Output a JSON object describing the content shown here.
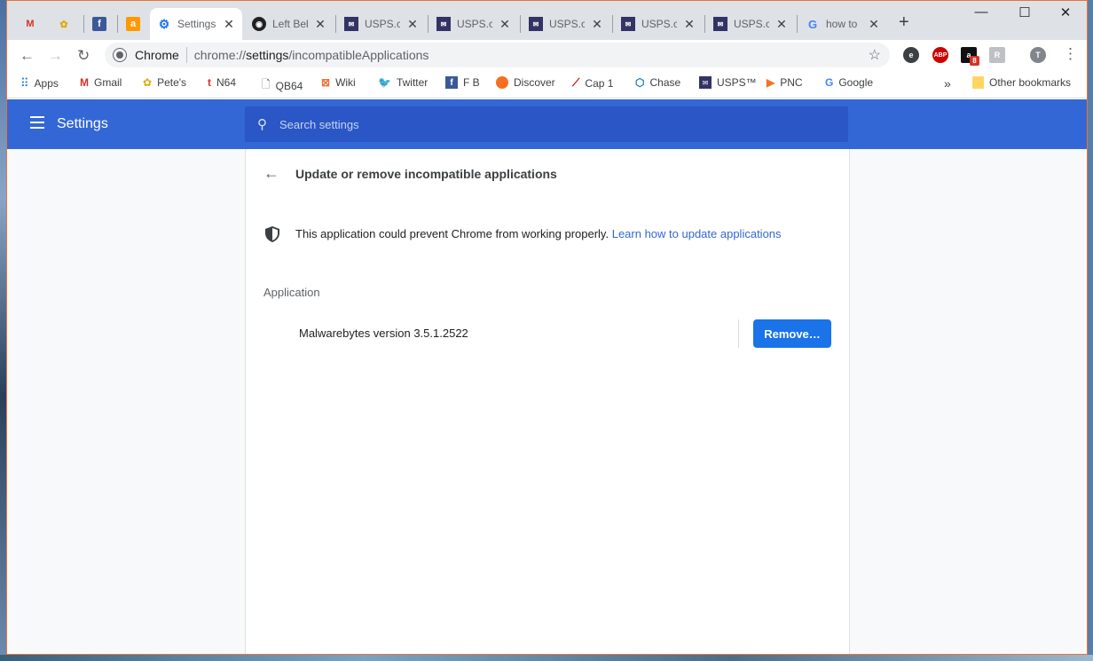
{
  "tabs": [
    {
      "title": "",
      "icon": "gmail-icon"
    },
    {
      "title": "",
      "icon": "petes-icon"
    },
    {
      "title": "",
      "icon": "facebook-icon"
    },
    {
      "title": "",
      "icon": "amazon-icon"
    },
    {
      "title": "Settings",
      "icon": "gear-icon",
      "active": true
    },
    {
      "title": "Left Bel",
      "icon": "circle-icon"
    },
    {
      "title": "USPS.co",
      "icon": "usps-icon"
    },
    {
      "title": "USPS.co",
      "icon": "usps-icon"
    },
    {
      "title": "USPS.co",
      "icon": "usps-icon"
    },
    {
      "title": "USPS.co",
      "icon": "usps-icon"
    },
    {
      "title": "USPS.co",
      "icon": "usps-icon"
    },
    {
      "title": "how to",
      "icon": "google-icon"
    }
  ],
  "omnibox": {
    "label": "Chrome",
    "url_host": "chrome://",
    "url_path": "settings",
    "url_rest": "/incompatibleApplications"
  },
  "profile_initial": "T",
  "abp_label": "ABP",
  "ext_badge": "8",
  "bookmarks": [
    {
      "label": "Apps"
    },
    {
      "label": "Gmail"
    },
    {
      "label": "Pete's"
    },
    {
      "label": "N64"
    },
    {
      "label": "QB64"
    },
    {
      "label": "Wiki"
    },
    {
      "label": "Twitter"
    },
    {
      "label": "F B"
    },
    {
      "label": "Discover"
    },
    {
      "label": "Cap 1"
    },
    {
      "label": "Chase"
    },
    {
      "label": "USPS™"
    },
    {
      "label": "PNC"
    },
    {
      "label": "Google"
    }
  ],
  "other_bookmarks": "Other bookmarks",
  "overflow": "»",
  "settings": {
    "title": "Settings",
    "search_placeholder": "Search settings"
  },
  "page": {
    "title": "Update or remove incompatible applications",
    "warning": "This application could prevent Chrome from working properly.",
    "learn_link": "Learn how to update applications",
    "column_header": "Application",
    "app_name": "Malwarebytes version 3.5.1.2522",
    "remove_label": "Remove…"
  },
  "colors": {
    "accent": "#3367d6",
    "button": "#1a73e8",
    "frame_border": "#e8743b"
  }
}
